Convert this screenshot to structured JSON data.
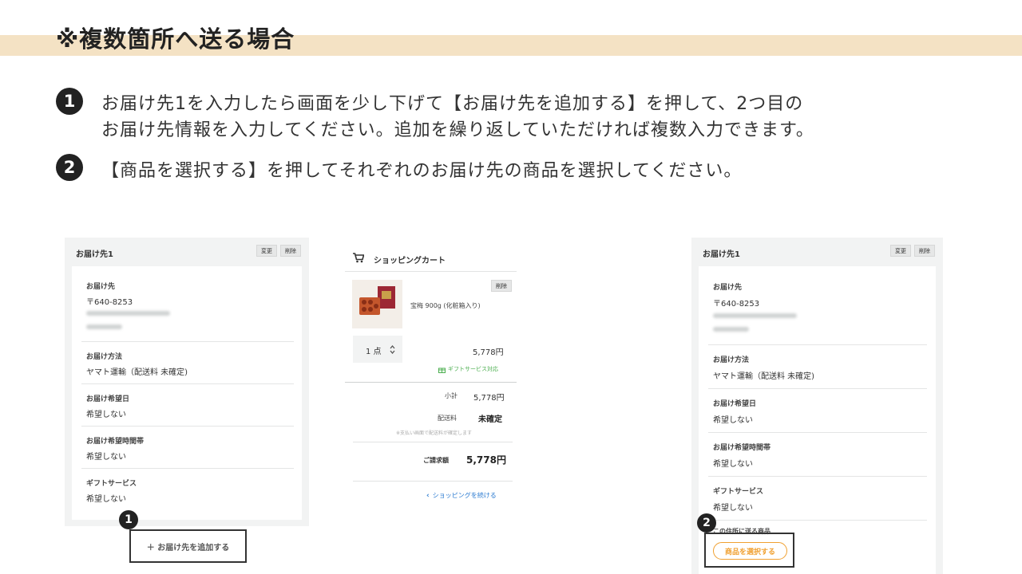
{
  "header": {
    "title": "※複数箇所へ送る場合"
  },
  "instructions": [
    {
      "number": "1",
      "lines": [
        "お届け先1を入力したら画面を少し下げて【お届け先を追加する】を押して、2つ目の",
        "お届け先情報を入力してください。追加を繰り返していただければ複数入力できます。"
      ]
    },
    {
      "number": "2",
      "lines": [
        "【商品を選択する】を押してそれぞれのお届け先の商品を選択してください。"
      ]
    }
  ],
  "left_panel": {
    "title": "お届け先1",
    "change_label": "変更",
    "delete_label": "削除",
    "address_label": "お届け先",
    "postal": "〒640-8253",
    "method_label": "お届け方法",
    "method_value": "ヤマト運輸（配送料 未確定)",
    "date_label": "お届け希望日",
    "date_value": "希望しない",
    "time_label": "お届け希望時間帯",
    "time_value": "希望しない",
    "gift_label": "ギフトサービス",
    "gift_value": "希望しない",
    "callout_number": "1",
    "add_button": "＋ お届け先を追加する"
  },
  "cart": {
    "title": "ショッピングカート",
    "delete_label": "削除",
    "product_name": "宝梅 900g (化粧箱入り)",
    "qty": "1 点",
    "price": "5,778円",
    "gift_badge": "ギフトサービス対応",
    "subtotal_label": "小計",
    "subtotal_value": "5,778円",
    "shipping_label": "配送料",
    "shipping_value": "未確定",
    "shipping_note": "※支払い画面で配送料が確定します",
    "total_label": "ご請求額",
    "total_value": "5,778円",
    "continue_label": "ショッピングを続ける"
  },
  "right_panel": {
    "title": "お届け先1",
    "change_label": "変更",
    "delete_label": "削除",
    "address_label": "お届け先",
    "postal": "〒640-8253",
    "method_label": "お届け方法",
    "method_value": "ヤマト運輸（配送料 未確定)",
    "date_label": "お届け希望日",
    "date_value": "希望しない",
    "time_label": "お届け希望時間帯",
    "time_value": "希望しない",
    "gift_label": "ギフトサービス",
    "gift_value": "希望しない",
    "products_label": "この住所に送る商品",
    "callout_number": "2",
    "select_button": "商品を選択する"
  },
  "colors": {
    "band": "#f4e2c4",
    "accent_orange": "#f0a030",
    "gift_green": "#4caf50",
    "link_blue": "#2a7ad0"
  }
}
